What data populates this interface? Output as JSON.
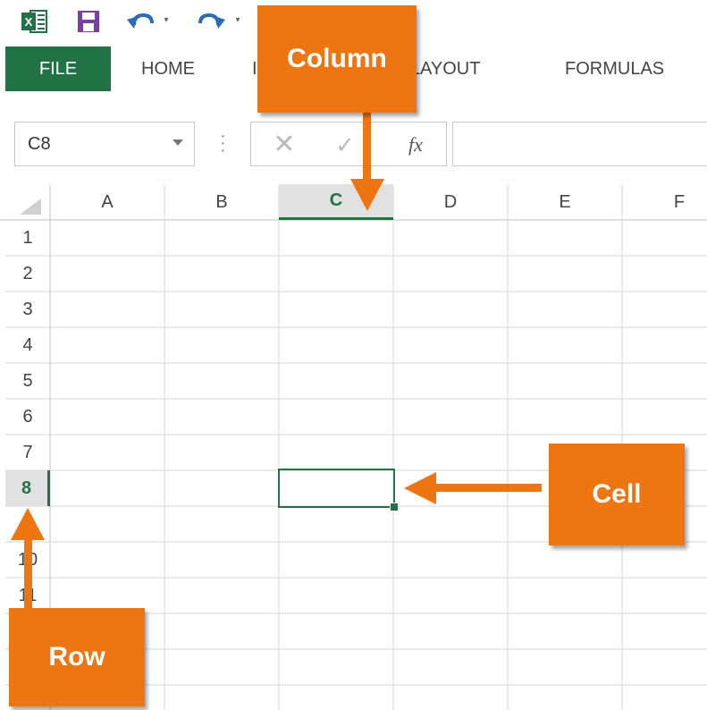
{
  "quick_access": {
    "excel_logo_letter": "X",
    "undo_dropdown": "▾",
    "redo_dropdown": "▾"
  },
  "ribbon": {
    "tabs": [
      {
        "label": "FILE"
      },
      {
        "label": "HOME"
      },
      {
        "label": "I"
      },
      {
        "label": "E LAYOUT"
      },
      {
        "label": "FORMULAS"
      }
    ]
  },
  "formula_bar": {
    "name_box_value": "C8",
    "cancel_glyph": "✕",
    "enter_glyph": "✓",
    "fx_label": "fx",
    "formula_value": ""
  },
  "grid": {
    "columns": [
      "A",
      "B",
      "C",
      "D",
      "E",
      "F"
    ],
    "rows": [
      "1",
      "2",
      "3",
      "4",
      "5",
      "6",
      "7",
      "8",
      "9",
      "10",
      "11"
    ],
    "active_column": "C",
    "active_row": "8"
  },
  "callouts": {
    "column": "Column",
    "cell": "Cell",
    "row": "Row"
  },
  "colors": {
    "accent_green": "#217346",
    "callout_orange": "#ed7512",
    "gridline": "#d4d4d4"
  }
}
